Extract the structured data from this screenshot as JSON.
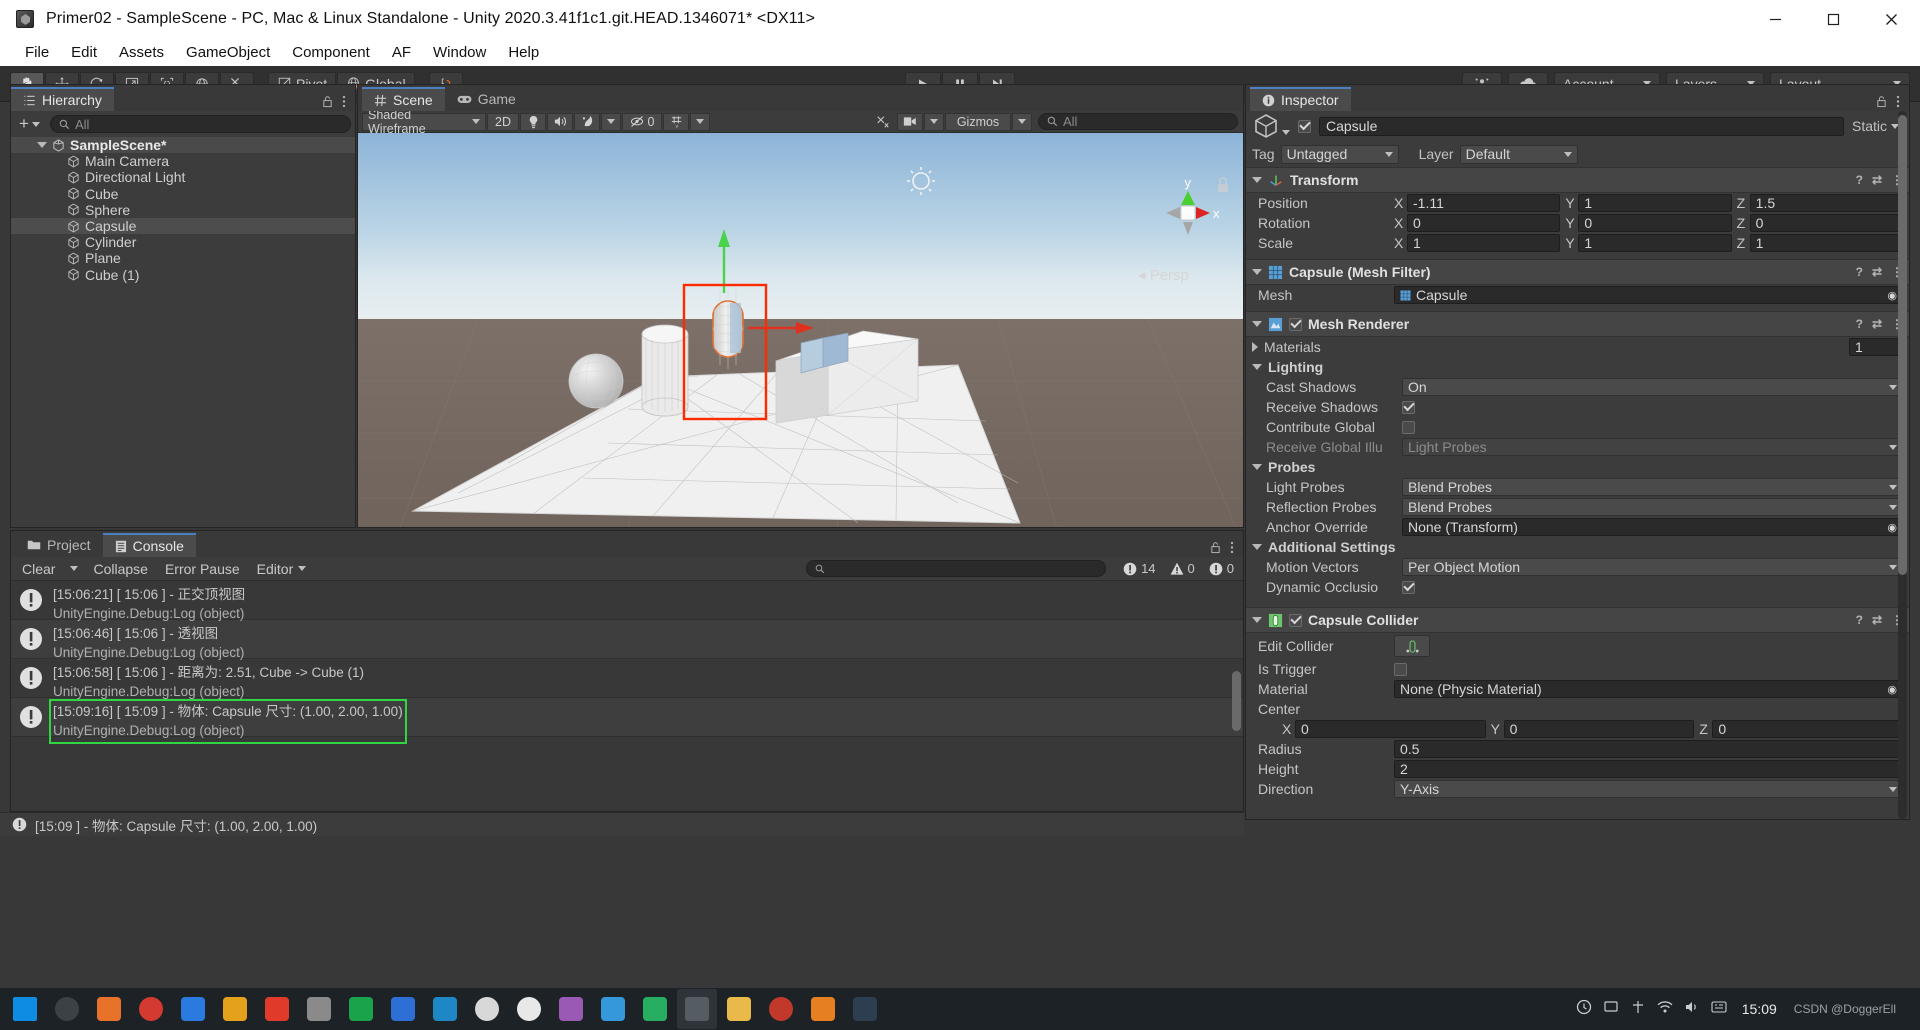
{
  "window": {
    "title": "Primer02 - SampleScene - PC, Mac & Linux Standalone - Unity 2020.3.41f1c1.git.HEAD.1346071* <DX11>",
    "minimize": "minimize-icon",
    "maximize": "maximize-icon",
    "close": "close-icon"
  },
  "menubar": {
    "items": [
      "File",
      "Edit",
      "Assets",
      "GameObject",
      "Component",
      "AF",
      "Window",
      "Help"
    ]
  },
  "toolbar": {
    "tools": [
      "hand-tool",
      "move-tool",
      "rotate-tool",
      "scale-tool",
      "rect-tool",
      "transform-tool",
      "custom-tool"
    ],
    "pivot_label": "Pivot",
    "global_label": "Global",
    "snap_label": "snap-increment",
    "play": "play-button",
    "pause": "pause-button",
    "step": "step-button",
    "collab_label": "collab-icon",
    "cloud_label": "cloud-icon",
    "account_label": "Account",
    "layers_label": "Layers",
    "layout_label": "Layout"
  },
  "hierarchy": {
    "tab_label": "Hierarchy",
    "search_placeholder": "All",
    "create_label": "+",
    "root": "SampleScene*",
    "items": [
      {
        "label": "Main Camera",
        "selected": false
      },
      {
        "label": "Directional Light",
        "selected": false
      },
      {
        "label": "Cube",
        "selected": false
      },
      {
        "label": "Sphere",
        "selected": false
      },
      {
        "label": "Capsule",
        "selected": true
      },
      {
        "label": "Cylinder",
        "selected": false
      },
      {
        "label": "Plane",
        "selected": false
      },
      {
        "label": "Cube (1)",
        "selected": false
      }
    ]
  },
  "scene": {
    "tabs": [
      {
        "label": "Scene",
        "icon": "scene-grid-icon",
        "selected": true
      },
      {
        "label": "Game",
        "icon": "gamepad-icon",
        "selected": false
      }
    ],
    "shading_mode": "Shaded Wireframe",
    "mode_2d": "2D",
    "lighting_toggle": "light-bulb-icon",
    "audio_toggle": "audio-icon",
    "fx_toggle": "fx-icon",
    "hidden_count": "0",
    "grid_icon": "grid-icon",
    "gizmos_label": "Gizmos",
    "gizmos_search_placeholder": "All",
    "persp_label": "Persp",
    "axis_y": "y",
    "axis_x": "x"
  },
  "inspector": {
    "tab_label": "Inspector",
    "object_name": "Capsule",
    "object_enabled": true,
    "static_label": "Static",
    "tag_label": "Tag",
    "tag_value": "Untagged",
    "layer_label": "Layer",
    "layer_value": "Default",
    "components": [
      {
        "name": "Transform",
        "icon": "transform-icon",
        "rows": [
          {
            "label": "Position",
            "x": "-1.11",
            "y": "1",
            "z": "1.5"
          },
          {
            "label": "Rotation",
            "x": "0",
            "y": "0",
            "z": "0"
          },
          {
            "label": "Scale",
            "x": "1",
            "y": "1",
            "z": "1"
          }
        ]
      }
    ],
    "mesh_filter": {
      "name": "Capsule (Mesh Filter)",
      "mesh_label": "Mesh",
      "mesh_value": "Capsule"
    },
    "mesh_renderer": {
      "name": "Mesh Renderer",
      "enabled": true,
      "materials_label": "Materials",
      "materials_count": "1",
      "lighting_label": "Lighting",
      "cast_shadows_label": "Cast Shadows",
      "cast_shadows_value": "On",
      "receive_shadows_label": "Receive Shadows",
      "receive_shadows_value": true,
      "contribute_global_label": "Contribute Global",
      "contribute_global_value": false,
      "receive_global_label": "Receive Global Illu",
      "receive_global_value": "Light Probes",
      "probes_label": "Probes",
      "light_probes_label": "Light Probes",
      "light_probes_value": "Blend Probes",
      "reflection_probes_label": "Reflection Probes",
      "reflection_probes_value": "Blend Probes",
      "anchor_override_label": "Anchor Override",
      "anchor_override_value": "None (Transform)",
      "additional_settings_label": "Additional Settings",
      "motion_vectors_label": "Motion Vectors",
      "motion_vectors_value": "Per Object Motion",
      "dynamic_occlusion_label": "Dynamic Occlusio",
      "dynamic_occlusion_value": true
    },
    "capsule_collider": {
      "name": "Capsule Collider",
      "enabled": true,
      "edit_collider_label": "Edit Collider",
      "is_trigger_label": "Is Trigger",
      "is_trigger_value": false,
      "material_label": "Material",
      "material_value": "None (Physic Material)",
      "center_label": "Center",
      "center_x": "0",
      "center_y": "0",
      "center_z": "0",
      "radius_label": "Radius",
      "radius_value": "0.5",
      "height_label": "Height",
      "height_value": "2",
      "direction_label": "Direction",
      "direction_value": "Y-Axis"
    }
  },
  "console": {
    "tabs": [
      {
        "label": "Project",
        "icon": "folder-icon",
        "selected": false
      },
      {
        "label": "Console",
        "icon": "console-icon",
        "selected": true
      }
    ],
    "clear_label": "Clear",
    "collapse_label": "Collapse",
    "error_pause_label": "Error Pause",
    "editor_label": "Editor",
    "search_placeholder": "",
    "counts": {
      "log": "14",
      "warning": "0",
      "error": "0"
    },
    "entries": [
      {
        "line1": "[15:06:21] [ 15:06 ] - 正交顶视图",
        "line2": "UnityEngine.Debug:Log (object)",
        "selected": false
      },
      {
        "line1": "[15:06:46] [ 15:06 ] - 透视图",
        "line2": "UnityEngine.Debug:Log (object)",
        "selected": false
      },
      {
        "line1": "[15:06:58] [ 15:06 ] - 距离为: 2.51, Cube -> Cube (1)",
        "line2": "UnityEngine.Debug:Log (object)",
        "selected": false
      },
      {
        "line1": "[15:09:16] [ 15:09 ] - 物体: Capsule 尺寸: (1.00, 2.00, 1.00)",
        "line2": "UnityEngine.Debug:Log (object)",
        "selected": true
      }
    ],
    "statusbar_text": "[15:09 ] - 物体: Capsule 尺寸: (1.00, 2.00, 1.00)"
  },
  "taskbar": {
    "clock_time": "15:09",
    "watermark": "CSDN @DoggerEll"
  }
}
